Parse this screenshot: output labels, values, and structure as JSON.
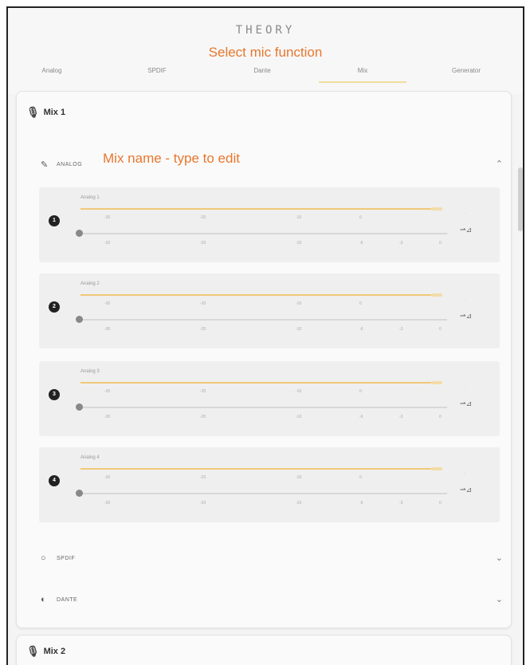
{
  "header": {
    "logo_text": "THEORY",
    "annotation_top": "Select mic function"
  },
  "tabs": [
    {
      "label": "Analog",
      "active": false
    },
    {
      "label": "SPDIF",
      "active": false
    },
    {
      "label": "Dante",
      "active": false
    },
    {
      "label": "Mix",
      "active": true
    },
    {
      "label": "Generator",
      "active": false
    }
  ],
  "mix1": {
    "title": "Mix 1",
    "icon": "mic-icon",
    "sections": {
      "analog": {
        "label": "ANALOG",
        "icon": "pencil-icon",
        "expanded": true
      },
      "spdif": {
        "label": "SPDIF",
        "icon": "circle-icon",
        "expanded": false
      },
      "dante": {
        "label": "DANTE",
        "icon": "dante-icon",
        "expanded": false
      }
    },
    "annotation_name": "Mix name - type to edit",
    "channels": [
      {
        "num": "1",
        "label": "Analog 1",
        "level": 0.96
      },
      {
        "num": "2",
        "label": "Analog 2",
        "level": 0.96
      },
      {
        "num": "3",
        "label": "Analog 3",
        "level": 0.96
      },
      {
        "num": "4",
        "label": "Analog 4",
        "level": 0.96
      }
    ],
    "scale_top": [
      "-30",
      "-20",
      "-10",
      "0"
    ],
    "scale_bottom": [
      "-30",
      "-20",
      "-10",
      "-6",
      "-3",
      "0"
    ]
  },
  "mix2": {
    "title": "Mix 2",
    "icon": "mic-icon"
  },
  "colors": {
    "accent_annotation": "#e8772e",
    "fader_gold": "#f0c878",
    "tab_underline": "#f2dca2"
  }
}
